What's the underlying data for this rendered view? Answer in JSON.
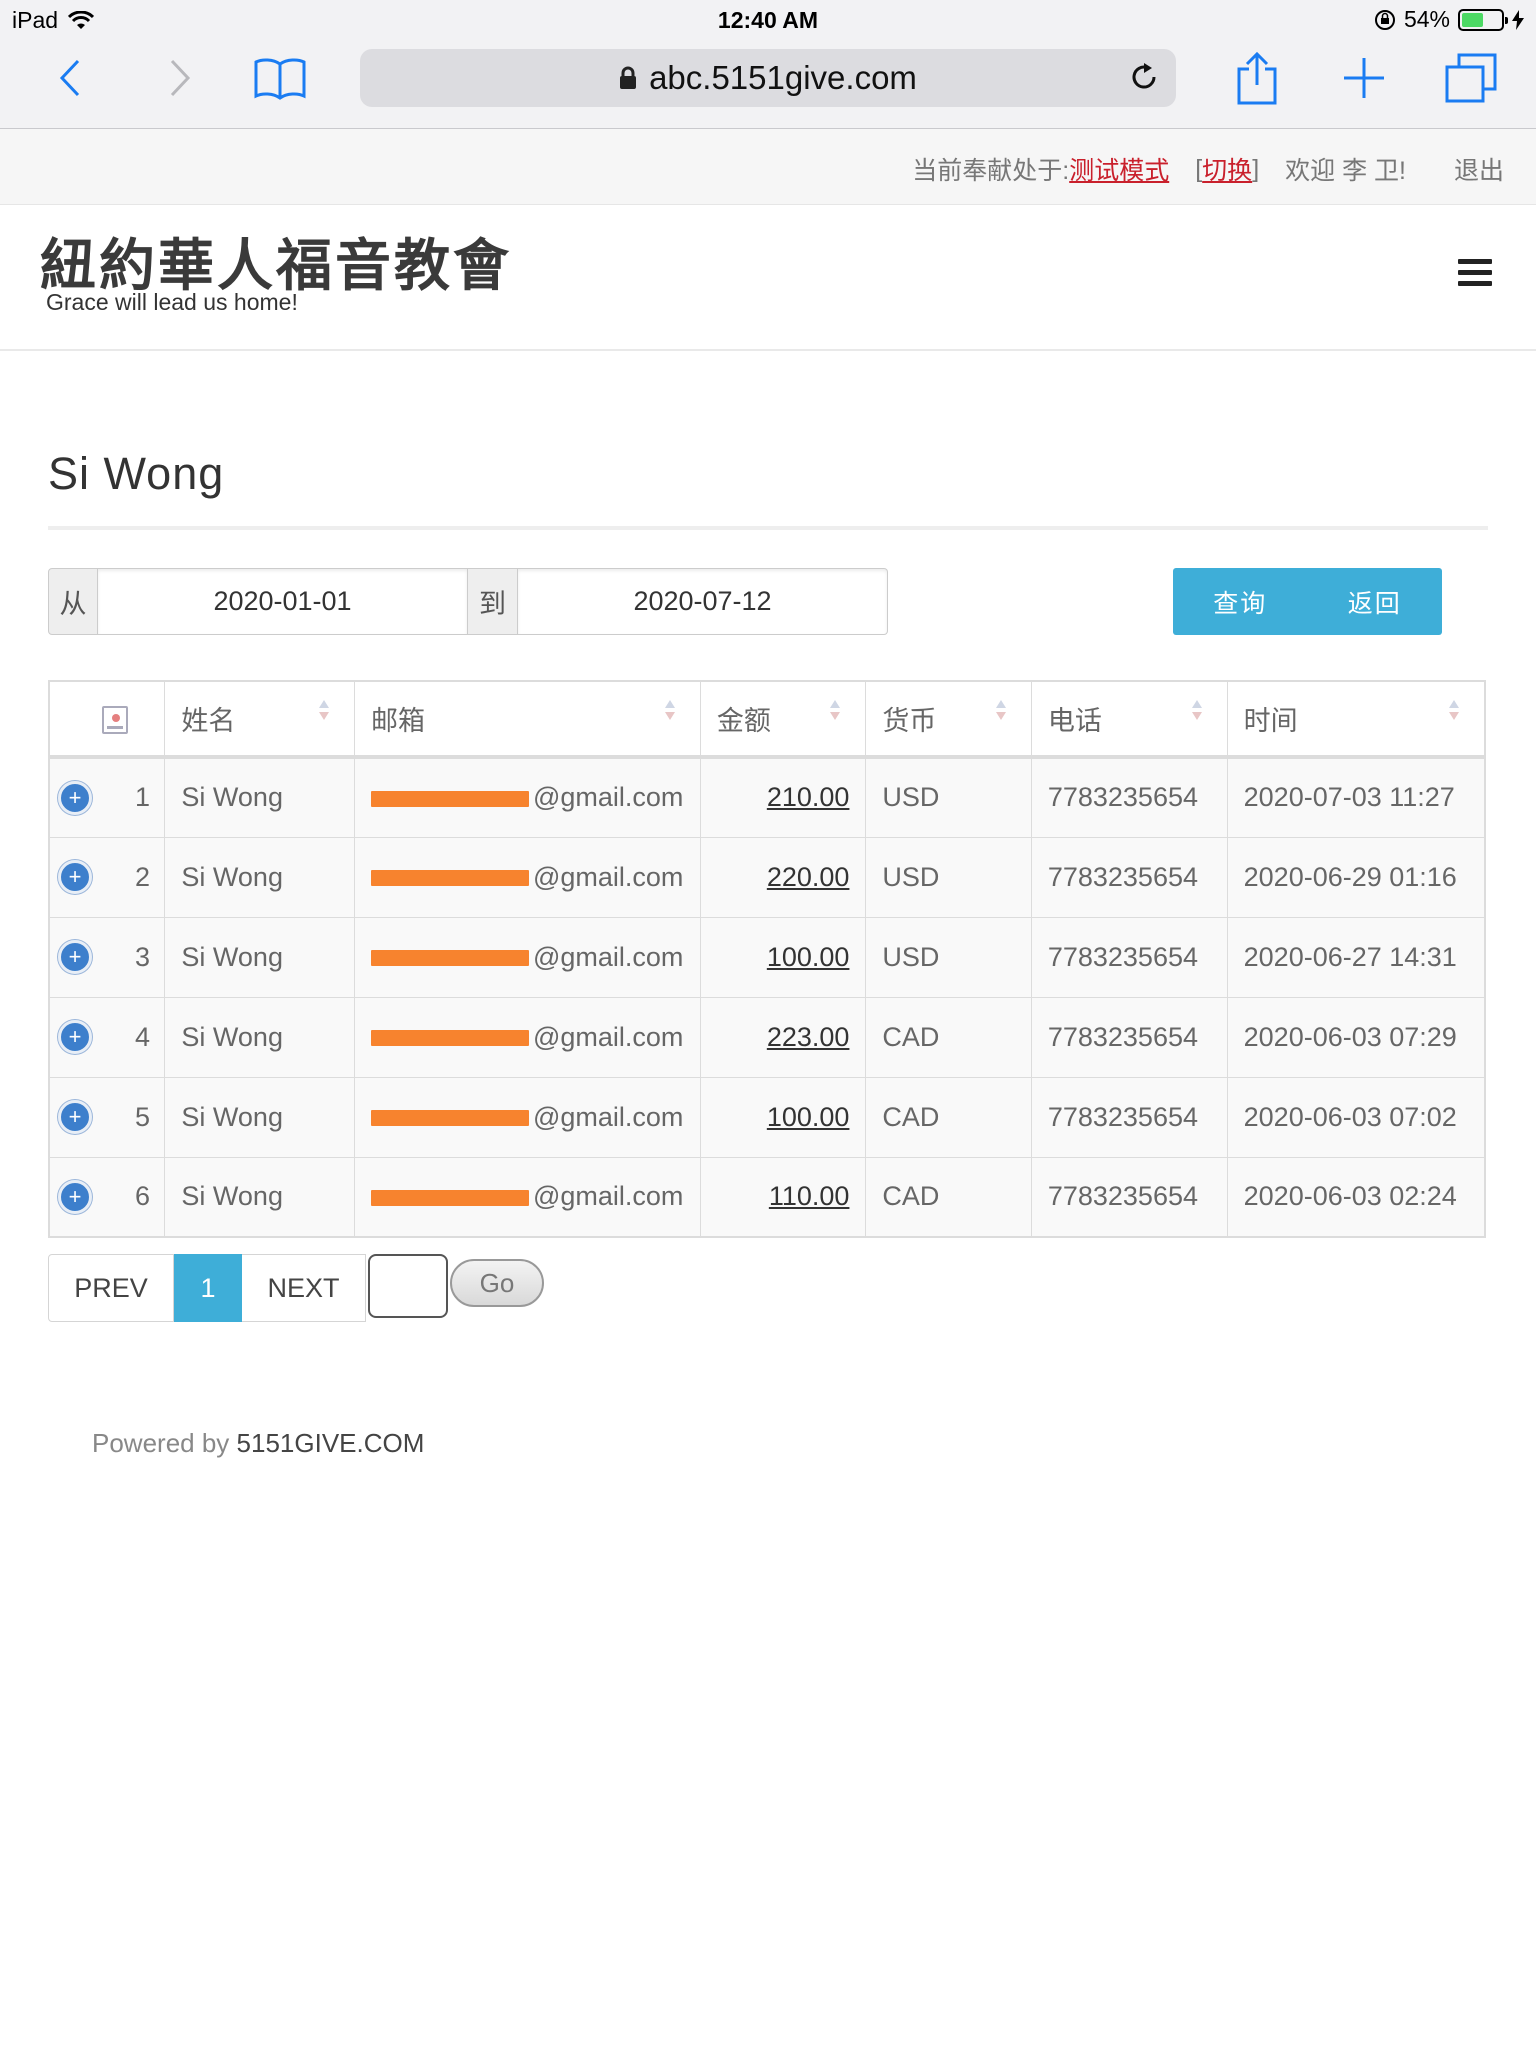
{
  "status_bar": {
    "device": "iPad",
    "time": "12:40 AM",
    "battery": "54%",
    "battery_level": 0.54
  },
  "browser": {
    "url": "abc.5151give.com"
  },
  "topbar": {
    "mode_prefix": "当前奉献处于: ",
    "mode": "测试模式",
    "switch": "切换",
    "welcome": "欢迎 李 卫!",
    "logout": "退出"
  },
  "header": {
    "title": "紐約華人福音教會",
    "tagline": "Grace will lead us home!"
  },
  "page": {
    "title": "Si Wong"
  },
  "filter": {
    "from_label": "从",
    "from_value": "2020-01-01",
    "to_label": "到",
    "to_value": "2020-07-12",
    "query_button": "查询",
    "back_button": "返回"
  },
  "table": {
    "columns": [
      "姓名",
      "邮箱",
      "金额",
      "货币",
      "电话",
      "时间"
    ],
    "rows": [
      {
        "no": "1",
        "name": "Si Wong",
        "email": "@gmail.com",
        "amount": "210.00",
        "currency": "USD",
        "phone": "7783235654",
        "time": "2020-07-03 11:27"
      },
      {
        "no": "2",
        "name": "Si Wong",
        "email": "@gmail.com",
        "amount": "220.00",
        "currency": "USD",
        "phone": "7783235654",
        "time": "2020-06-29 01:16"
      },
      {
        "no": "3",
        "name": "Si Wong",
        "email": "@gmail.com",
        "amount": "100.00",
        "currency": "USD",
        "phone": "7783235654",
        "time": "2020-06-27 14:31"
      },
      {
        "no": "4",
        "name": "Si Wong",
        "email": "@gmail.com",
        "amount": "223.00",
        "currency": "CAD",
        "phone": "7783235654",
        "time": "2020-06-03 07:29"
      },
      {
        "no": "5",
        "name": "Si Wong",
        "email": "@gmail.com",
        "amount": "100.00",
        "currency": "CAD",
        "phone": "7783235654",
        "time": "2020-06-03 07:02"
      },
      {
        "no": "6",
        "name": "Si Wong",
        "email": "@gmail.com",
        "amount": "110.00",
        "currency": "CAD",
        "phone": "7783235654",
        "time": "2020-06-03 02:24"
      }
    ]
  },
  "pagination": {
    "prev": "PREV",
    "current": "1",
    "next": "NEXT",
    "go": "Go"
  },
  "footer": {
    "prefix": "Powered by ",
    "brand": "5151GIVE.COM"
  },
  "colors": {
    "accent": "#3eaed8",
    "alert_red": "#c9202c",
    "redaction": "#f7832e",
    "ios_blue": "#1a7cf2"
  },
  "icons": [
    "wifi-icon",
    "orientation-lock-icon",
    "battery-icon",
    "charging-icon",
    "back-arrow-icon",
    "forward-arrow-icon",
    "bookmarks-icon",
    "lock-icon",
    "reload-icon",
    "share-icon",
    "new-tab-icon",
    "tabs-icon",
    "hamburger-icon",
    "sort-icon",
    "expand-row-icon"
  ]
}
